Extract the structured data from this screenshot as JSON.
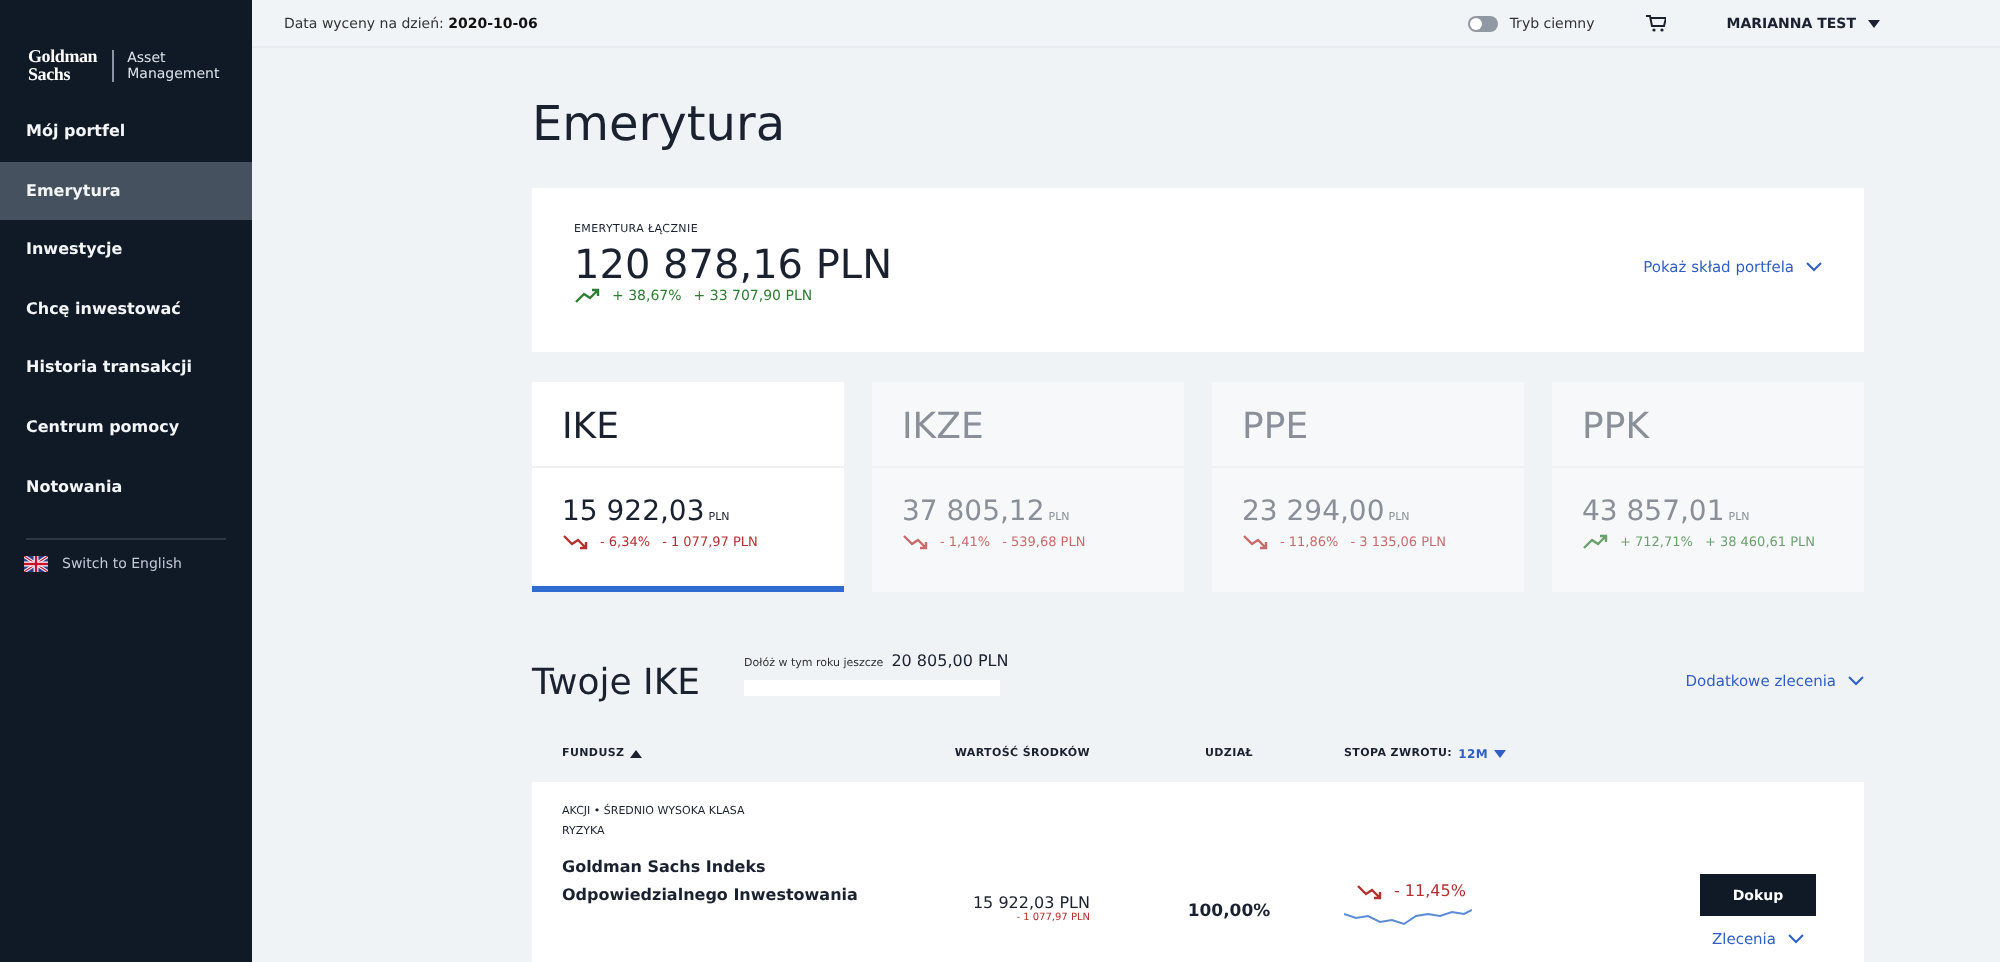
{
  "sidebar": {
    "logo": {
      "brand_lines": [
        "Goldman",
        "Sachs"
      ],
      "division_lines": [
        "Asset",
        "Management"
      ]
    },
    "items": [
      {
        "label": "Mój portfel",
        "selected": false
      },
      {
        "label": "Emerytura",
        "selected": true
      },
      {
        "label": "Inwestycje",
        "selected": false
      },
      {
        "label": "Chcę inwestować",
        "selected": false
      },
      {
        "label": "Historia transakcji",
        "selected": false
      },
      {
        "label": "Centrum pomocy",
        "selected": false
      },
      {
        "label": "Notowania",
        "selected": false
      }
    ],
    "language_link": "Switch to English"
  },
  "header": {
    "date_label": "Data wyceny na dzień:",
    "date_value": "2020-10-06",
    "dark_mode": {
      "label": "Tryb ciemny",
      "on": false
    },
    "user": "MARIANNA TEST"
  },
  "page_title": "Emerytura",
  "summary": {
    "label": "EMERYTURA ŁĄCZNIE",
    "amount": "120 878,16 PLN",
    "kind": "up",
    "change_percent": "+ 38,67%",
    "change_amount": "+ 33 707,90 PLN",
    "link": "Pokaż skład portfela"
  },
  "tabs": [
    {
      "label": "IKE",
      "amount": "15 922,03",
      "currency": "PLN",
      "kind": "down",
      "change_percent": "- 6,34%",
      "change_amount": "- 1 077,97 PLN",
      "selected": true
    },
    {
      "label": "IKZE",
      "amount": "37 805,12",
      "currency": "PLN",
      "kind": "down",
      "change_percent": "- 1,41%",
      "change_amount": "- 539,68 PLN",
      "selected": false
    },
    {
      "label": "PPE",
      "amount": "23 294,00",
      "currency": "PLN",
      "kind": "down",
      "change_percent": "- 11,86%",
      "change_amount": "- 3 135,06 PLN",
      "selected": false
    },
    {
      "label": "PPK",
      "amount": "43 857,01",
      "currency": "PLN",
      "kind": "up",
      "change_percent": "+ 712,71%",
      "change_amount": "+ 38 460,61 PLN",
      "selected": false
    }
  ],
  "section": {
    "title": "Twoje IKE",
    "limit_label": "Dołóż w tym roku jeszcze",
    "limit_value": "20 805,00 PLN",
    "link": "Dodatkowe zlecenia"
  },
  "table": {
    "columns": [
      {
        "label": "FUNDUSZ",
        "kind": "sorted"
      },
      {
        "label": "WARTOŚĆ ŚRODKÓW",
        "kind": "plain"
      },
      {
        "label": "UDZIAŁ",
        "kind": "plain"
      },
      {
        "label": "STOPA ZWROTU:",
        "kind": "period",
        "period": "12M"
      }
    ],
    "rows": [
      {
        "category": "AKCJI • ŚREDNIO WYSOKA KLASA RYZYKA",
        "name": "Goldman Sachs Indeks Odpowiedzialnego Inwestowania",
        "value": "15 922,03 PLN",
        "value_change": "- 1 077,97 PLN",
        "share": "100,00%",
        "kind": "down",
        "return": "- 11,45%",
        "button": "Dokup",
        "orders_link": "Zlecenia"
      }
    ]
  }
}
